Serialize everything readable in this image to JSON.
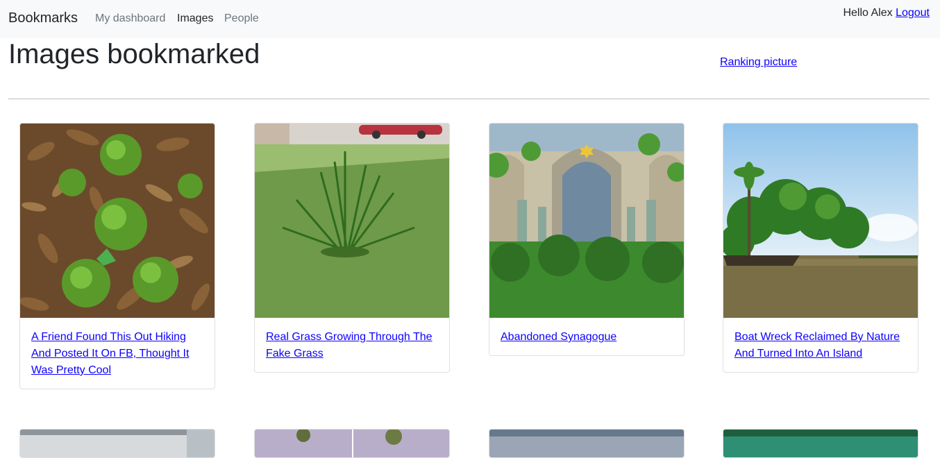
{
  "navbar": {
    "brand": "Bookmarks",
    "links": [
      {
        "label": "My dashboard",
        "active": false
      },
      {
        "label": "Images",
        "active": true
      },
      {
        "label": "People",
        "active": false
      }
    ],
    "greeting": "Hello Alex",
    "logout_label": "Logout"
  },
  "main": {
    "title": "Images bookmarked",
    "ranking_link": "Ranking picture",
    "cards": [
      {
        "title": "A Friend Found This Out Hiking And Posted It On FB, Thought It Was Pretty Cool",
        "image": "moss-balls-on-leaves"
      },
      {
        "title": "Real Grass Growing Through The Fake Grass",
        "image": "grass-tuft"
      },
      {
        "title": "Abandoned Synagogue",
        "image": "overgrown-synagogue"
      },
      {
        "title": "Boat Wreck Reclaimed By Nature And Turned Into An Island",
        "image": "boat-wreck-island"
      }
    ],
    "second_row_images": [
      "building-window",
      "tree-branches",
      "mountain-sky",
      "green-lake"
    ]
  },
  "colors": {
    "link": "#0d00ff",
    "navbar_bg": "#f8f9fa",
    "muted_nav": "#6c757d"
  }
}
